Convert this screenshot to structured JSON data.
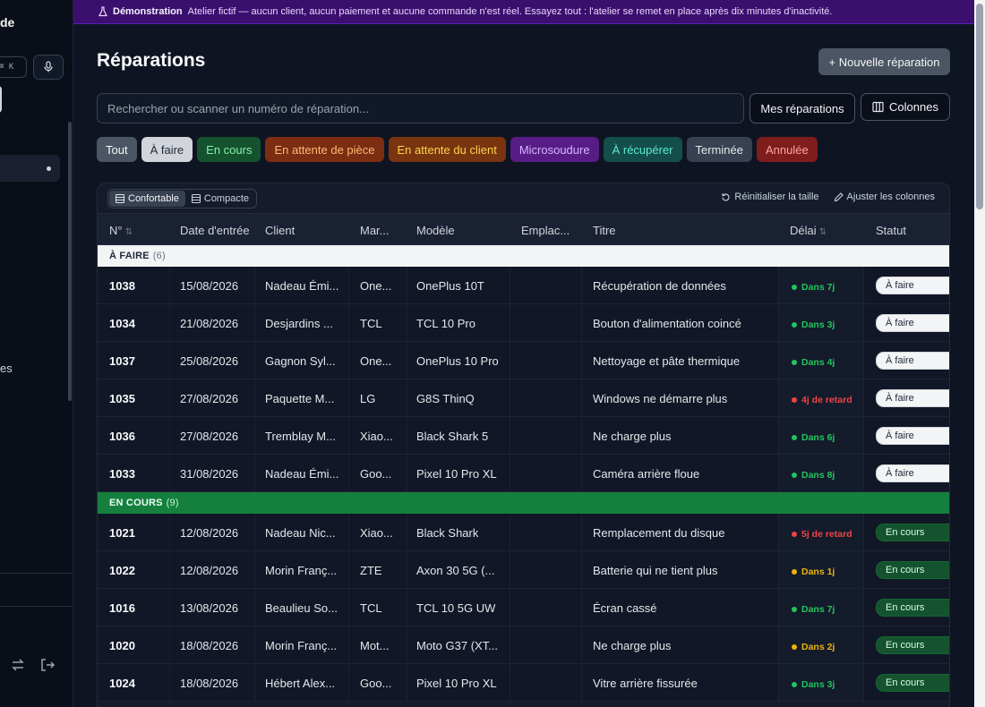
{
  "sidebar": {
    "brand_fragment": "de",
    "shortcut": "⌘ K",
    "nav_fragment": "es"
  },
  "banner": {
    "title": "Démonstration",
    "text": "Atelier fictif — aucun client, aucun paiement et aucune commande n'est réel. Essayez tout : l'atelier se remet en place après dix minutes d'inactivité."
  },
  "page": {
    "title": "Réparations",
    "new_button": "+ Nouvelle réparation",
    "search_placeholder": "Rechercher ou scanner un numéro de réparation...",
    "mine_button": "Mes réparations",
    "columns_button": "Colonnes"
  },
  "filters": [
    {
      "label": "Tout",
      "bg": "#4b5563",
      "fg": "#f9fafb"
    },
    {
      "label": "À faire",
      "bg": "#d1d5db",
      "fg": "#1f2937"
    },
    {
      "label": "En cours",
      "bg": "#14532d",
      "fg": "#86efac"
    },
    {
      "label": "En attente de pièce",
      "bg": "#7c2d12",
      "fg": "#fdba74"
    },
    {
      "label": "En attente du client",
      "bg": "#78350f",
      "fg": "#fcd34d"
    },
    {
      "label": "Microsoudure",
      "bg": "#581c87",
      "fg": "#d8b4fe"
    },
    {
      "label": "À récupérer",
      "bg": "#134e4a",
      "fg": "#5eead4"
    },
    {
      "label": "Terminée",
      "bg": "#374151",
      "fg": "#e5e7eb"
    },
    {
      "label": "Annulée",
      "bg": "#7f1d1d",
      "fg": "#fca5a5"
    }
  ],
  "toolbar": {
    "comfortable": "Confortable",
    "compact": "Compacte",
    "reset_size": "Réinitialiser la taille",
    "adjust_columns": "Ajuster les colonnes"
  },
  "columns": [
    "N°",
    "Date d'entrée",
    "Client",
    "Mar...",
    "Modèle",
    "Emplac...",
    "Titre",
    "Délai",
    "Statut"
  ],
  "groups": [
    {
      "label": "À FAIRE",
      "count": "(6)",
      "status_class": "todo",
      "rows": [
        {
          "num": "1038",
          "date": "15/08/2026",
          "client": "Nadeau Émi...",
          "brand": "One...",
          "model": "OnePlus 10T",
          "title": "Récupération de données",
          "delay": "Dans 7j",
          "delay_color": "#22c55e",
          "status": "À faire"
        },
        {
          "num": "1034",
          "date": "21/08/2026",
          "client": "Desjardins ...",
          "brand": "TCL",
          "model": "TCL 10 Pro",
          "title": "Bouton d'alimentation coincé",
          "delay": "Dans 3j",
          "delay_color": "#22c55e",
          "status": "À faire"
        },
        {
          "num": "1037",
          "date": "25/08/2026",
          "client": "Gagnon Syl...",
          "brand": "One...",
          "model": "OnePlus 10 Pro",
          "title": "Nettoyage et pâte thermique",
          "delay": "Dans 4j",
          "delay_color": "#22c55e",
          "status": "À faire"
        },
        {
          "num": "1035",
          "date": "27/08/2026",
          "client": "Paquette M...",
          "brand": "LG",
          "model": "G8S ThinQ",
          "title": "Windows ne démarre plus",
          "delay": "4j de retard",
          "delay_color": "#ef4444",
          "status": "À faire"
        },
        {
          "num": "1036",
          "date": "27/08/2026",
          "client": "Tremblay M...",
          "brand": "Xiao...",
          "model": "Black Shark 5",
          "title": "Ne charge plus",
          "delay": "Dans 6j",
          "delay_color": "#22c55e",
          "status": "À faire"
        },
        {
          "num": "1033",
          "date": "31/08/2026",
          "client": "Nadeau Émi...",
          "brand": "Goo...",
          "model": "Pixel 10 Pro XL",
          "title": "Caméra arrière floue",
          "delay": "Dans 8j",
          "delay_color": "#22c55e",
          "status": "À faire"
        }
      ]
    },
    {
      "label": "EN COURS",
      "count": "(9)",
      "status_class": "prog",
      "rows": [
        {
          "num": "1021",
          "date": "12/08/2026",
          "client": "Nadeau Nic...",
          "brand": "Xiao...",
          "model": "Black Shark",
          "title": "Remplacement du disque",
          "delay": "5j de retard",
          "delay_color": "#ef4444",
          "status": "En cours"
        },
        {
          "num": "1022",
          "date": "12/08/2026",
          "client": "Morin Franç...",
          "brand": "ZTE",
          "model": "Axon 30 5G (...",
          "title": "Batterie qui ne tient plus",
          "delay": "Dans 1j",
          "delay_color": "#eab308",
          "status": "En cours"
        },
        {
          "num": "1016",
          "date": "13/08/2026",
          "client": "Beaulieu So...",
          "brand": "TCL",
          "model": "TCL 10 5G UW",
          "title": "Écran cassé",
          "delay": "Dans 7j",
          "delay_color": "#22c55e",
          "status": "En cours"
        },
        {
          "num": "1020",
          "date": "18/08/2026",
          "client": "Morin Franç...",
          "brand": "Mot...",
          "model": "Moto G37 (XT...",
          "title": "Ne charge plus",
          "delay": "Dans 2j",
          "delay_color": "#eab308",
          "status": "En cours"
        },
        {
          "num": "1024",
          "date": "18/08/2026",
          "client": "Hébert Alex...",
          "brand": "Goo...",
          "model": "Pixel 10 Pro XL",
          "title": "Vitre arrière fissurée",
          "delay": "Dans 3j",
          "delay_color": "#22c55e",
          "status": "En cours"
        }
      ]
    }
  ]
}
